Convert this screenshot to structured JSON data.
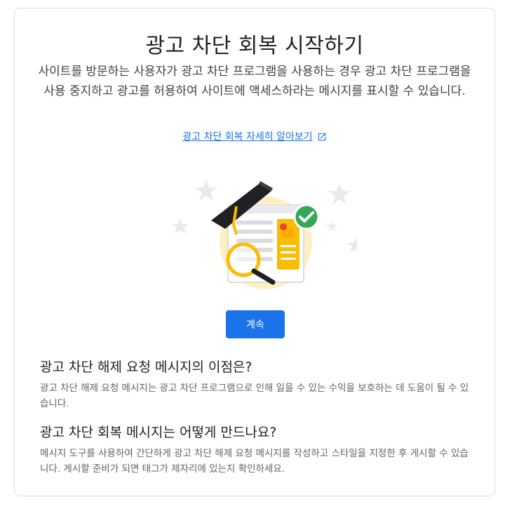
{
  "page": {
    "title": "광고 차단 회복 시작하기",
    "description": "사이트를 방문하는 사용자가 광고 차단 프로그램을 사용하는 경우 광고 차단 프로그램을 사용 중지하고 광고를 허용하여 사이트에 액세스하라는 메시지를 표시할 수 있습니다.",
    "learn_more_link": "광고 차단 회복 자세히 알아보기",
    "continue_button": "계속"
  },
  "faq": [
    {
      "question": "광고 차단 해제 요청 메시지의 이점은?",
      "answer": "광고 차단 해제 요청 메시지는 광고 차단 프로그램으로 인해 잃을 수 있는 수익을 보호하는 데 도움이 될 수 있습니다."
    },
    {
      "question": "광고 차단 회복 메시지는 어떻게 만드나요?",
      "answer": "메시지 도구를 사용하여 간단하게 광고 차단 해제 요청 메시지를 작성하고 스타일을 지정한 후 게시할 수 있습니다. 게시할 준비가 되면 태그가 제자리에 있는지 확인하세요."
    }
  ],
  "icons": {
    "external_link": "open-in-new-icon",
    "illustration": "graduation-cap-document-magnifier-illustration",
    "check": "check-circle-icon"
  },
  "colors": {
    "accent": "#1a73e8",
    "success": "#34a853",
    "highlight": "#fbbc04"
  }
}
